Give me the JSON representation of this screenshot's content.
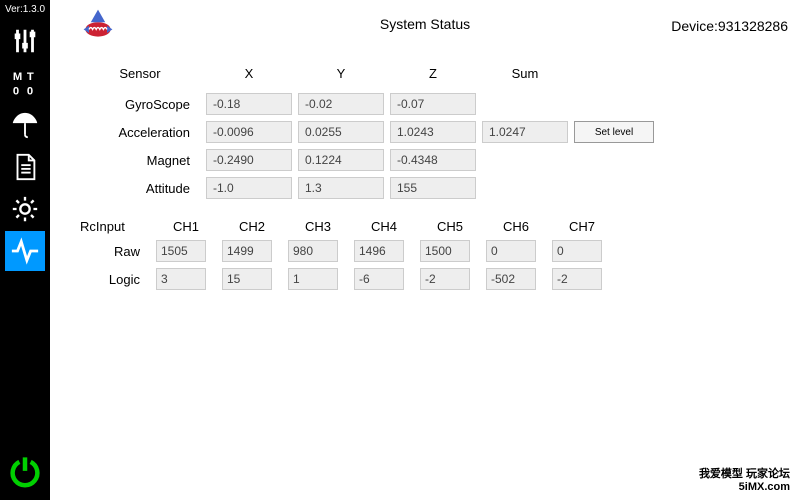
{
  "version": "Ver:1.3.0",
  "header": {
    "title": "System Status",
    "device_label": "Device:",
    "device_id": "931328286"
  },
  "sensor_headers": {
    "sensor": "Sensor",
    "x": "X",
    "y": "Y",
    "z": "Z",
    "sum": "Sum"
  },
  "sensors": {
    "gyro": {
      "label": "GyroScope",
      "x": "-0.18",
      "y": "-0.02",
      "z": "-0.07"
    },
    "accel": {
      "label": "Acceleration",
      "x": "-0.0096",
      "y": "0.0255",
      "z": "1.0243",
      "sum": "1.0247"
    },
    "mag": {
      "label": "Magnet",
      "x": "-0.2490",
      "y": "0.1224",
      "z": "-0.4348"
    },
    "att": {
      "label": "Attitude",
      "x": "-1.0",
      "y": "1.3",
      "z": "155"
    }
  },
  "set_level_label": "Set level",
  "rc": {
    "title": "RcInput",
    "channels": [
      "CH1",
      "CH2",
      "CH3",
      "CH4",
      "CH5",
      "CH6",
      "CH7"
    ],
    "raw_label": "Raw",
    "raw": [
      "1505",
      "1499",
      "980",
      "1496",
      "1500",
      "0",
      "0"
    ],
    "logic_label": "Logic",
    "logic": [
      "3",
      "15",
      "1",
      "-6",
      "-2",
      "-502",
      "-2"
    ]
  },
  "watermark": {
    "line1": "我爱模型 玩家论坛",
    "line2": "5iMX.com"
  }
}
